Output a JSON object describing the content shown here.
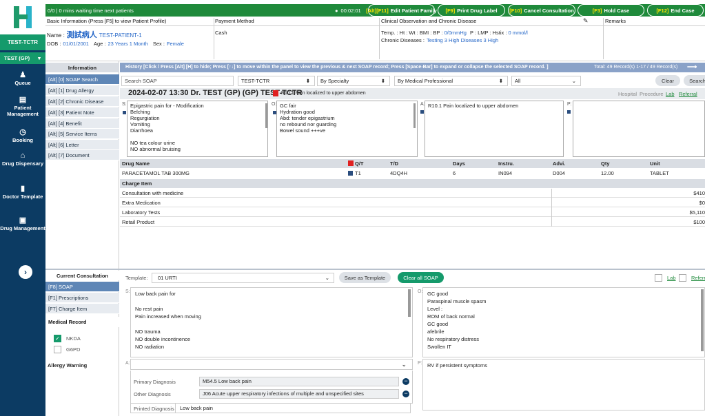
{
  "nav": {
    "tabs": [
      "TEST-TCTR",
      "TEST (GP)"
    ],
    "items": [
      "Queue",
      "Patient Management",
      "Booking",
      "Drug Dispensary",
      "Doctor Template",
      "Drug Management"
    ],
    "arrow": "›"
  },
  "topbar": {
    "queue_status": "0/0 | 0 mins waiting time next patients",
    "timer": "00:02:01",
    "buttons": [
      {
        "key": "[Alt][F11]",
        "label": "Edit Patient Family"
      },
      {
        "key": "[F9]",
        "label": "Print Drug Label"
      },
      {
        "key": "[F10]",
        "label": "Cancel Consultation"
      },
      {
        "key": "[F3]",
        "label": "Hold Case"
      },
      {
        "key": "[F12]",
        "label": "End Case"
      }
    ]
  },
  "patient": {
    "basic_header": "Basic Information  (Press [F5] to view Patient Profile)",
    "name_label": "Name :",
    "name_cn": "測試病人",
    "name_en": "TEST-PATIENT-1",
    "dob_label": "DOB :",
    "dob": "01/01/2001",
    "age_label": "Age :",
    "age": "23 Years 1 Month",
    "sex_label": "Sex :",
    "sex": "Female",
    "payment_header": "Payment Method",
    "payment": "Cash",
    "clinical_header": "Clinical Observation and Chronic Disease",
    "vitals": "Temp. :   Ht :   Wt :   BMI :   BP :",
    "bp": "0/0mmHg",
    "vitals2": "P :   LMP :   Hstix :",
    "hstix": "0 mmol/l",
    "chronic_label": "Chronic Diseases :",
    "chronic": "Testing 3 High Diseases   3 High",
    "remarks_header": "Remarks"
  },
  "left": {
    "info_header": "Information",
    "info_items": [
      "[Alt] [0]  SOAP Search",
      "[Alt] [1]  Drug Allergy",
      "[Alt] [2]  Chronic Disease",
      "[Alt] [3]  Patient Note",
      "[Alt] [4]  Benefit",
      "[Alt] [5]  Service Items",
      "[Alt] [6]  Letter",
      "[Alt] [7]  Document"
    ],
    "consult_header": "Current Consultation",
    "consult_items": [
      "[F8]  SOAP",
      "[F1]  Prescriptions",
      "[F7]  Charge Item"
    ],
    "medical_record_header": "Medical Record",
    "records": [
      {
        "label": "NKDA",
        "checked": true
      },
      {
        "label": "G6PD",
        "checked": false
      }
    ],
    "allergy_header": "Allergy Warning"
  },
  "history": {
    "bar_text": "History   [Click / Press [Alt] [H] to hide; Press [↑↓] to move within the panel to view the previous & next SOAP record; Press [Space-Bar] to expand or collapse the selected SOAP record. ]",
    "total": "Total: 49 Record(s)    1-17  /  49  Record(s)",
    "search_placeholder": "Search SOAP",
    "filter_clinic": "TEST-TCTR",
    "filter_specialty": "By Specialty",
    "filter_professional": "By Medical Professional",
    "filter_all": "All",
    "clear": "Clear",
    "search": "Search",
    "record_title": "2024-02-07 13:30 Dr. TEST (GP) (GP) TEST-TCTR",
    "record_dx": "R10.1 Pain localized to upper abdomen",
    "links": {
      "hospital": "Hospital",
      "procedure": "Procedure",
      "lab": "Lab",
      "referral": "Referral"
    },
    "s_label": "S:",
    "o_label": "O:",
    "a_label": "A:",
    "p_label": "P:",
    "s_lines": [
      "Epigastric pain for - Modification",
      "Belching",
      "Regurgiation",
      "Vomiting",
      "Diarrhoea",
      "",
      "NO tea colour urine",
      "NO abnormal bruising"
    ],
    "o_lines": [
      "GC fair",
      "Hydration good",
      "Abd: tender epigastrium",
      "no rebound nor guarding",
      "Bowel sound +++ve"
    ],
    "a_lines": [
      "R10.1 Pain localized to upper abdomen"
    ],
    "drug_headers": [
      "Drug Name",
      "Q/T",
      "T/D",
      "Days",
      "Instru.",
      "Advi.",
      "Qty",
      "Unit"
    ],
    "drug_row": [
      "PARACETAMOL TAB 300MG",
      "T1",
      "4DQ4H",
      "6",
      "IN094",
      "D004",
      "12.00",
      "TABLET"
    ],
    "charge_header": "Charge Item",
    "charges": [
      {
        "name": "Consultation with medicine",
        "amount": "$410"
      },
      {
        "name": "Extra Medication",
        "amount": "$0"
      },
      {
        "name": "Laboratory Tests",
        "amount": "$5,110"
      },
      {
        "name": "Retail Product",
        "amount": "$100"
      }
    ]
  },
  "soap": {
    "template_label": "Template:",
    "template_value": "01 URTI",
    "save_template": "Save as Template",
    "clear_all": "Clear all SOAP",
    "lab": "Lab",
    "referral": "Referr",
    "s_label": "S:",
    "o_label": "O:",
    "a_label": "A:",
    "p_label": "P:",
    "s_lines": [
      "Low back pain for",
      "",
      "No rest pain",
      "Pain increased when moving",
      "",
      "NO trauma",
      "NO double incontinence",
      "NO radiation"
    ],
    "o_lines": [
      "GC good",
      "Paraspinal muscle spasm",
      "Level :",
      "ROM of back normal",
      "GC good",
      "afebrile",
      "No respiratory distress",
      "Swollen IT"
    ],
    "p_text": "RV if persistent symptoms",
    "primary_label": "Primary Diagnosis",
    "primary_value": "M54.5 Low back pain",
    "other_label": "Other Diagnosis",
    "other_value": "J06 Acute upper respiratory infections of multiple and unspecified sites",
    "printed_label": "Printed Diagnosis",
    "printed_value": "Low back pain"
  },
  "colors": {
    "navy": "#0c3b63",
    "green": "#1f8a3b",
    "teal": "#159a6b",
    "bar": "#8aa2c8",
    "accent": "#ffe600"
  }
}
